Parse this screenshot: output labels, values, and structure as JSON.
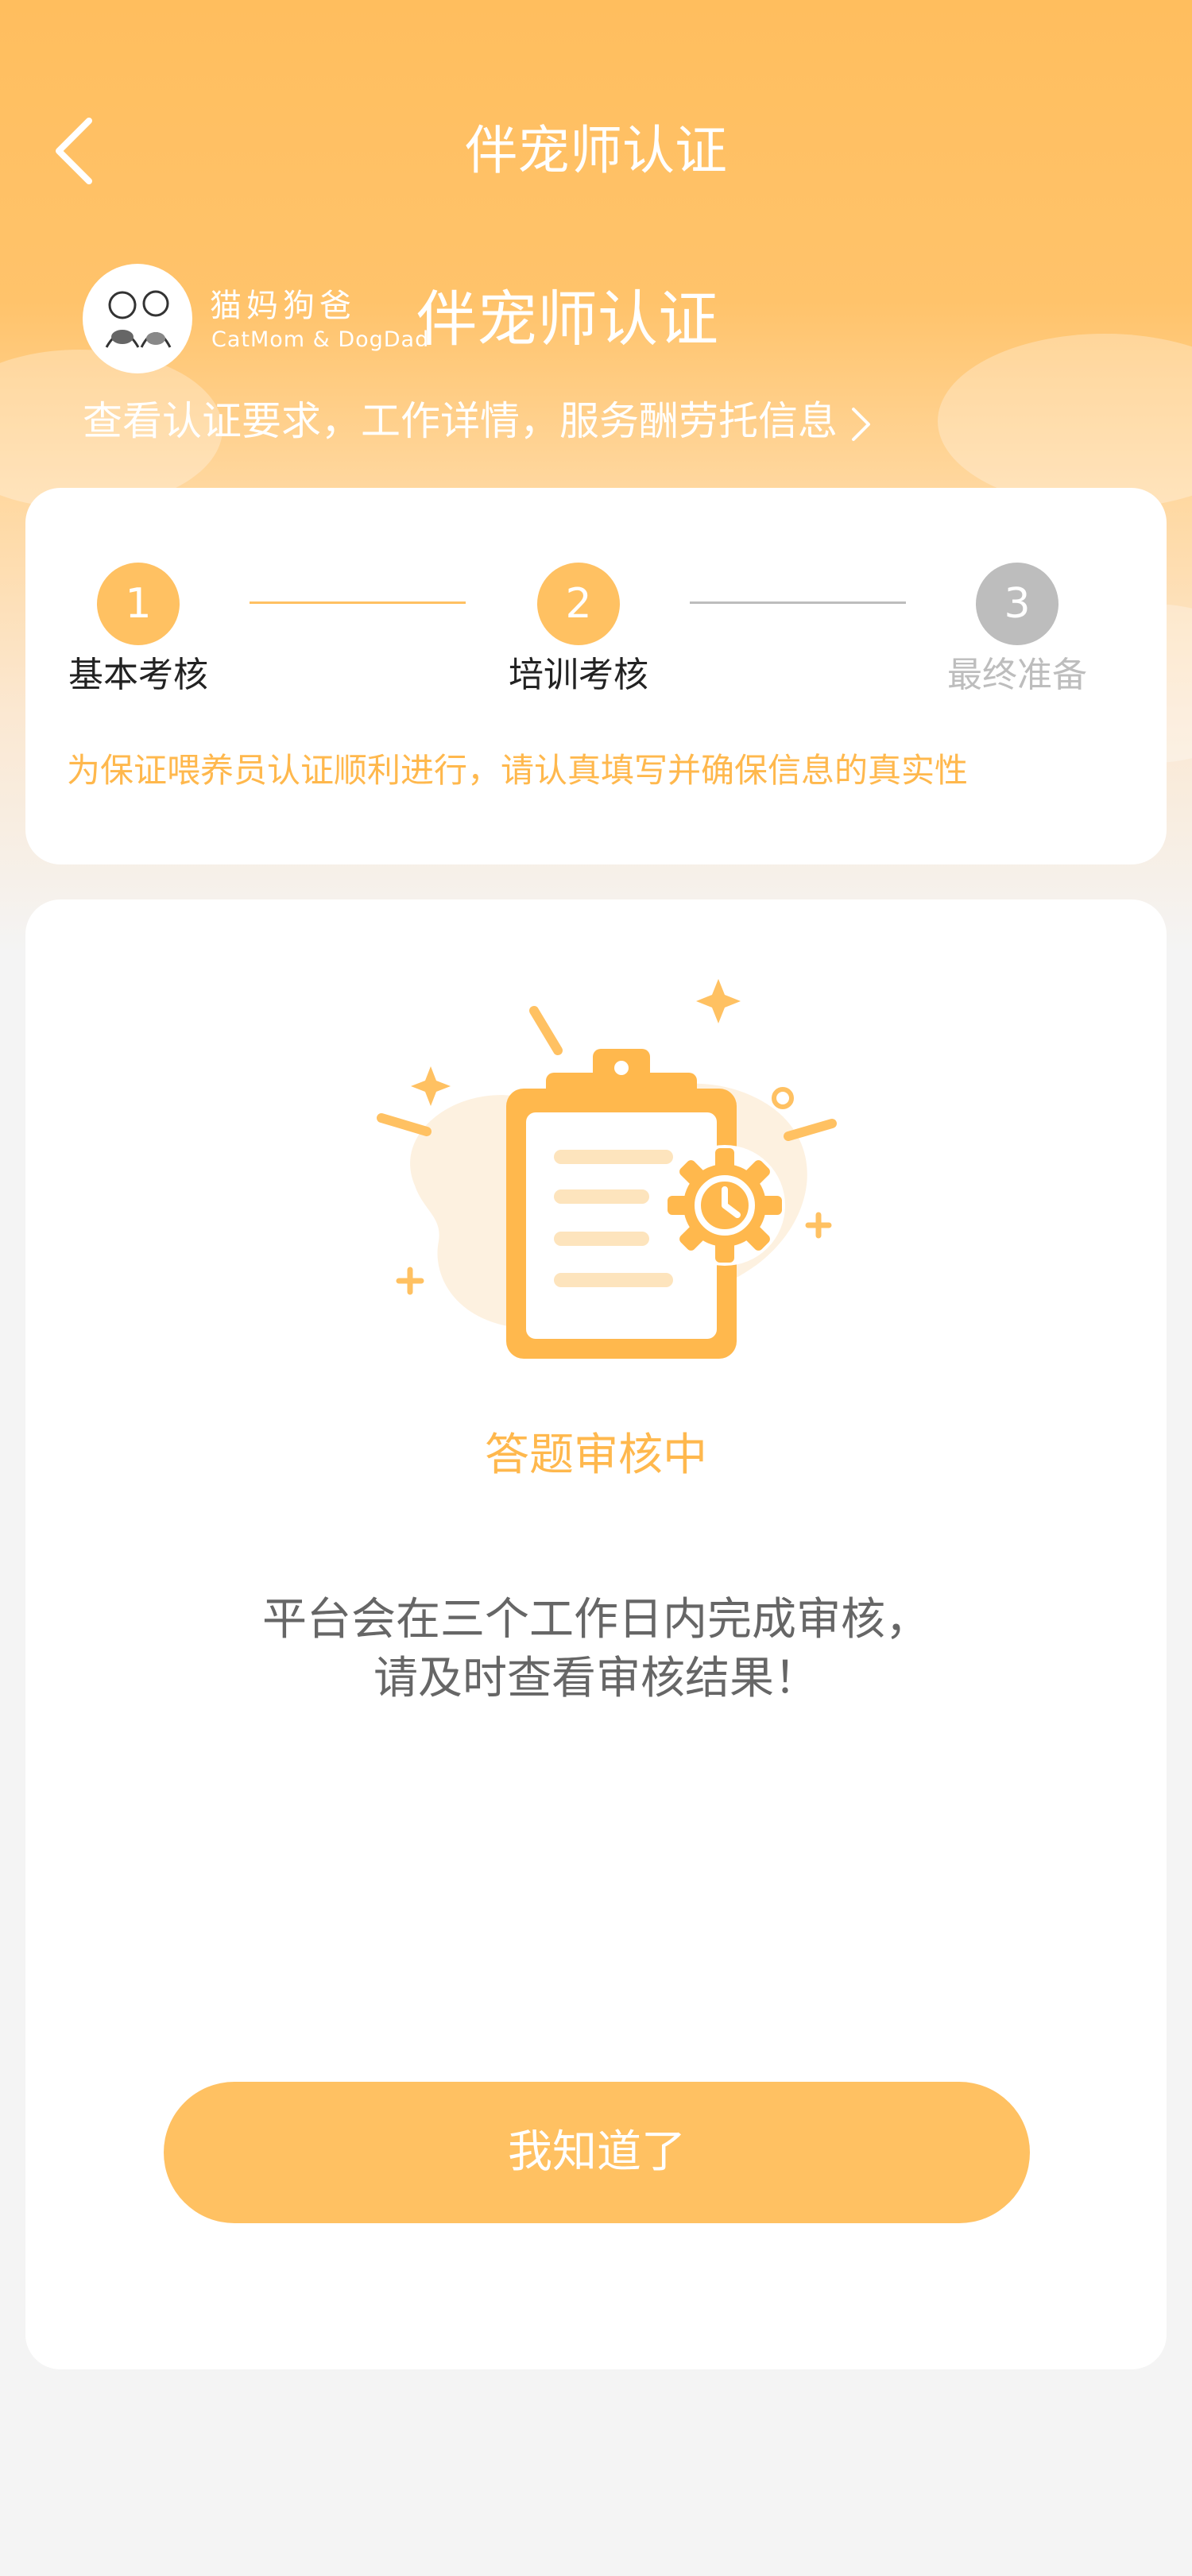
{
  "nav": {
    "title": "伴宠师认证"
  },
  "brand": {
    "logo_cn": "猫妈狗爸",
    "logo_en": "CatMom & DogDad",
    "title": "伴宠师认证",
    "info_link": "查看认证要求，工作详情，服务酬劳托信息"
  },
  "steps": [
    {
      "number": "1",
      "label": "基本考核",
      "state": "done"
    },
    {
      "number": "2",
      "label": "培训考核",
      "state": "active"
    },
    {
      "number": "3",
      "label": "最终准备",
      "state": "pending"
    }
  ],
  "notice": "为保证喂养员认证顺利进行，请认真填写并确保信息的真实性",
  "status": {
    "title": "答题审核中",
    "desc_line1": "平台会在三个工作日内完成审核，",
    "desc_line2": "请及时查看审核结果！"
  },
  "button": {
    "label": "我知道了"
  },
  "colors": {
    "accent": "#ffb84d",
    "button": "#ffc162",
    "inactive": "#bdbdbd"
  }
}
